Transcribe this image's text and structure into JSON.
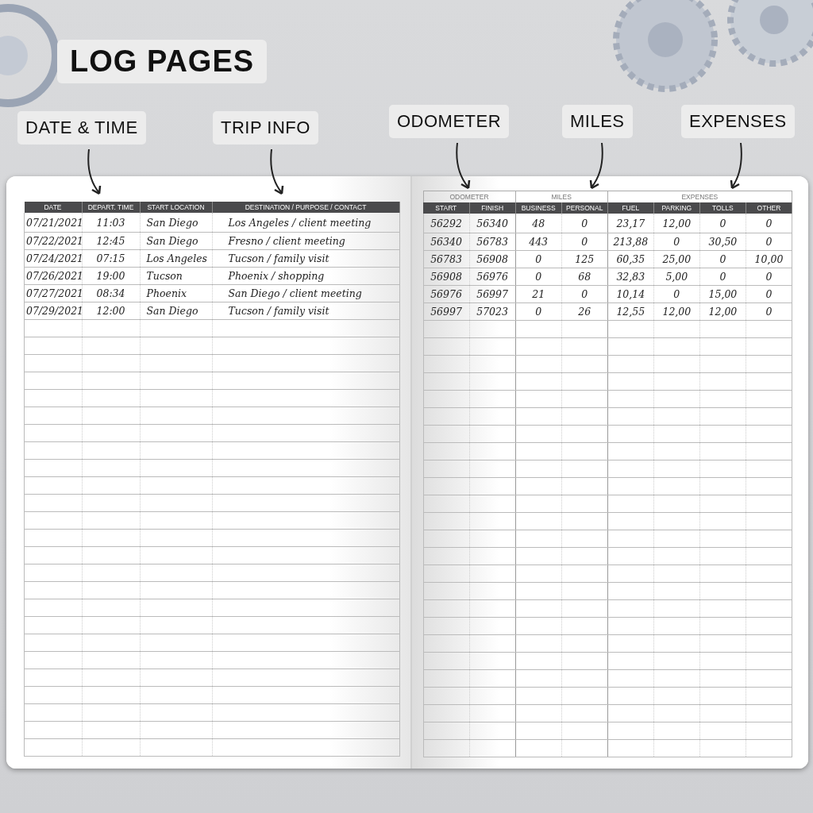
{
  "title": "LOG PAGES",
  "callouts": [
    {
      "label": "DATE & TIME"
    },
    {
      "label": "TRIP INFO"
    },
    {
      "label": "ODOMETER"
    },
    {
      "label": "MILES"
    },
    {
      "label": "EXPENSES"
    }
  ],
  "left_page": {
    "columns": [
      "DATE",
      "DEPART. TIME",
      "START LOCATION",
      "DESTINATION / PURPOSE / CONTACT"
    ],
    "rows": [
      [
        "07/21/2021",
        "11:03",
        "San Diego",
        "Los Angeles / client meeting"
      ],
      [
        "07/22/2021",
        "12:45",
        "San Diego",
        "Fresno / client meeting"
      ],
      [
        "07/24/2021",
        "07:15",
        "Los Angeles",
        "Tucson / family visit"
      ],
      [
        "07/26/2021",
        "19:00",
        "Tucson",
        "Phoenix / shopping"
      ],
      [
        "07/27/2021",
        "08:34",
        "Phoenix",
        "San Diego / client meeting"
      ],
      [
        "07/29/2021",
        "12:00",
        "San Diego",
        "Tucson / family visit"
      ]
    ]
  },
  "right_page": {
    "groups": [
      {
        "label": "ODOMETER",
        "columns": [
          "START",
          "FINISH"
        ]
      },
      {
        "label": "MILES",
        "columns": [
          "BUSINESS",
          "PERSONAL"
        ]
      },
      {
        "label": "EXPENSES",
        "columns": [
          "FUEL",
          "PARKING",
          "TOLLS",
          "OTHER"
        ]
      }
    ],
    "rows": [
      [
        "56292",
        "56340",
        "48",
        "0",
        "23,17",
        "12,00",
        "0",
        "0"
      ],
      [
        "56340",
        "56783",
        "443",
        "0",
        "213,88",
        "0",
        "30,50",
        "0"
      ],
      [
        "56783",
        "56908",
        "0",
        "125",
        "60,35",
        "25,00",
        "0",
        "10,00"
      ],
      [
        "56908",
        "56976",
        "0",
        "68",
        "32,83",
        "5,00",
        "0",
        "0"
      ],
      [
        "56976",
        "56997",
        "21",
        "0",
        "10,14",
        "0",
        "15,00",
        "0"
      ],
      [
        "56997",
        "57023",
        "0",
        "26",
        "12,55",
        "12,00",
        "12,00",
        "0"
      ]
    ]
  }
}
